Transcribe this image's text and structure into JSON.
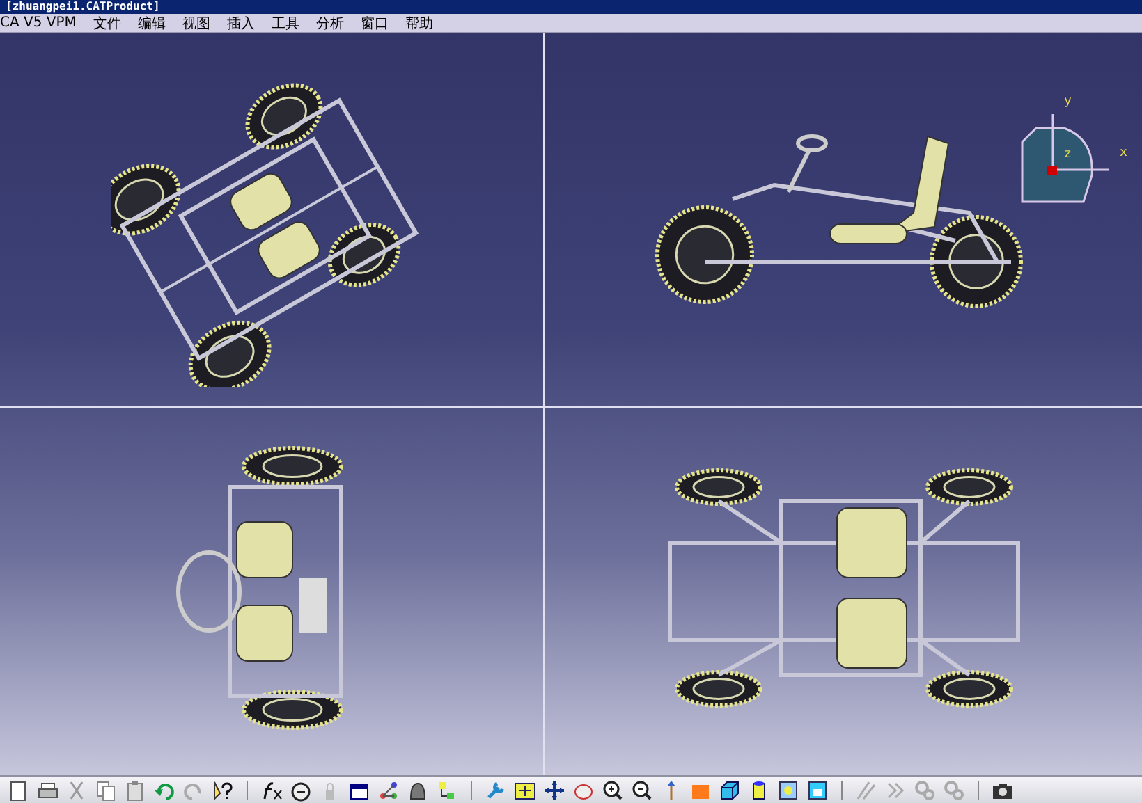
{
  "window": {
    "title": "[zhuangpei1.CATProduct]"
  },
  "menu_bar": {
    "app_label": "CA V5 VPM",
    "items": [
      "文件",
      "编辑",
      "视图",
      "插入",
      "工具",
      "分析",
      "窗口",
      "帮助"
    ]
  },
  "compass": {
    "labels": [
      "y",
      "z",
      "x"
    ]
  }
}
